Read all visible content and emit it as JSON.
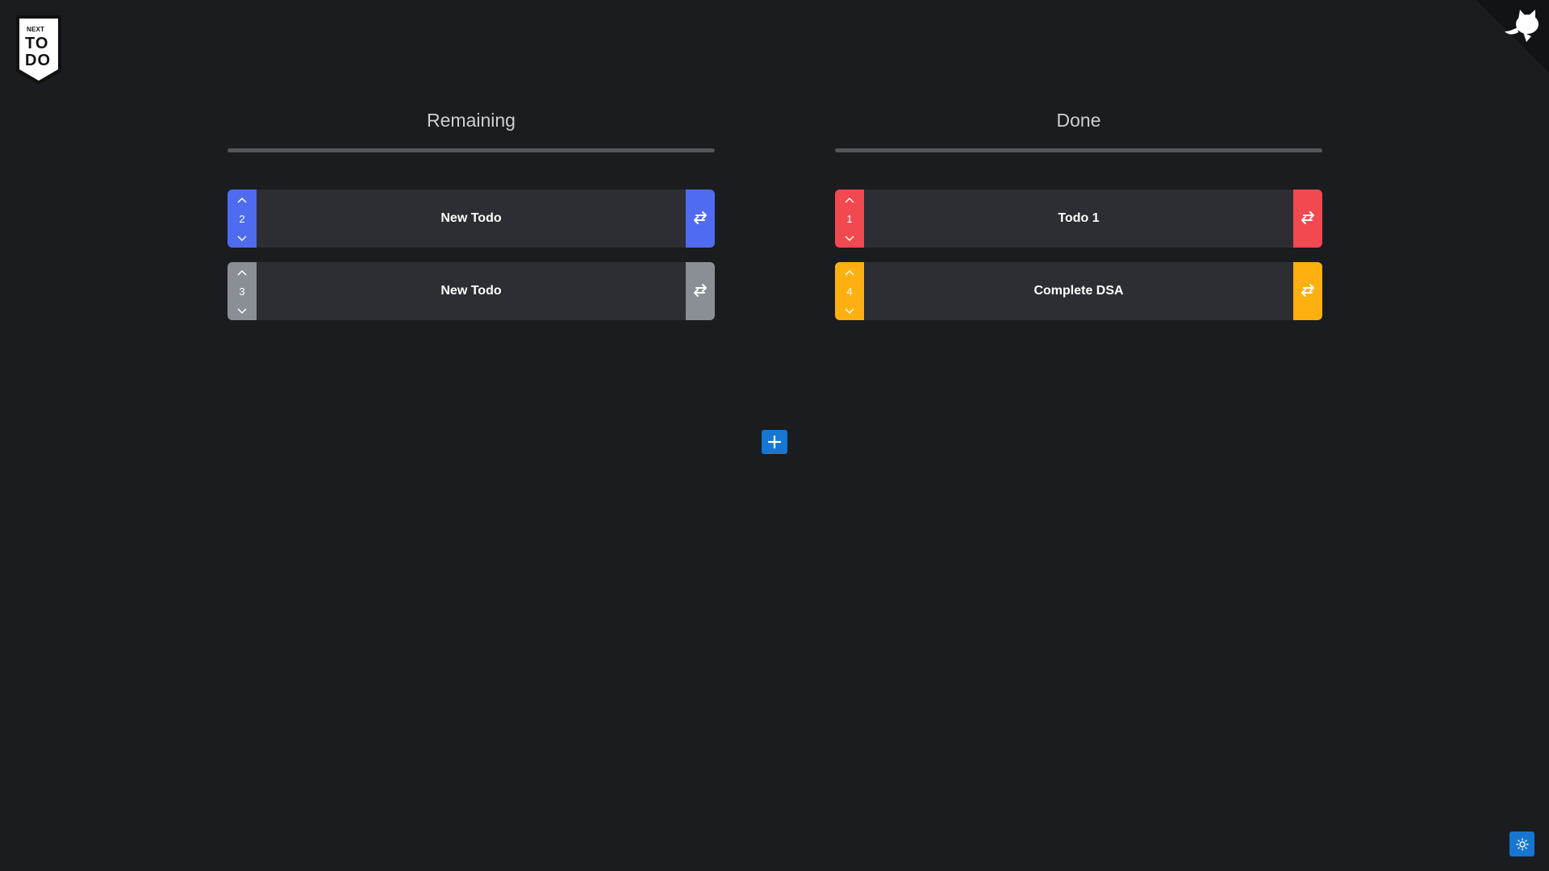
{
  "logo": {
    "small": "NEXT",
    "line1": "TO",
    "line2": "DO"
  },
  "icons": {
    "github": "github-octocat-icon",
    "up": "chevron-up-icon",
    "down": "chevron-down-icon",
    "swap": "swap-arrows-icon",
    "add": "plus-icon",
    "theme": "sun-icon"
  },
  "columns": {
    "remaining": {
      "title": "Remaining",
      "items": [
        {
          "order": "2",
          "title": "New Todo",
          "color": "#4f6cf0"
        },
        {
          "order": "3",
          "title": "New Todo",
          "color": "#8a8e95"
        }
      ]
    },
    "done": {
      "title": "Done",
      "items": [
        {
          "order": "1",
          "title": "Todo 1",
          "color": "#f2484f"
        },
        {
          "order": "4",
          "title": "Complete DSA",
          "color": "#fdb00f"
        }
      ]
    }
  },
  "colors": {
    "background": "#1b1c20",
    "card": "#2d2e33",
    "accent": "#1676d2"
  }
}
